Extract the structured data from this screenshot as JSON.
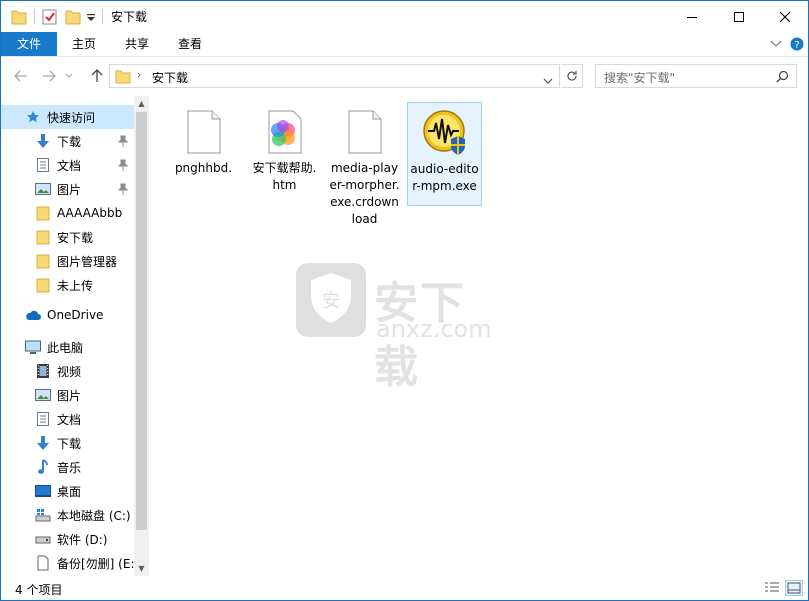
{
  "window": {
    "title": "安下载",
    "accent": "#1979ca"
  },
  "ribbon": {
    "tabs": [
      {
        "label": "文件"
      },
      {
        "label": "主页"
      },
      {
        "label": "共享"
      },
      {
        "label": "查看"
      }
    ]
  },
  "address": {
    "crumb": "安下载",
    "search_placeholder": "搜索\"安下载\""
  },
  "nav": {
    "quick_access": "快速访问",
    "quick_items": [
      {
        "label": "下载",
        "icon": "download-arrow-icon",
        "pinned": true
      },
      {
        "label": "文档",
        "icon": "document-icon",
        "pinned": true
      },
      {
        "label": "图片",
        "icon": "pictures-icon",
        "pinned": true
      },
      {
        "label": "AAAAAbbb",
        "icon": "folder-icon",
        "pinned": false
      },
      {
        "label": "安下载",
        "icon": "folder-icon",
        "pinned": false
      },
      {
        "label": "图片管理器",
        "icon": "folder-icon",
        "pinned": false
      },
      {
        "label": "未上传",
        "icon": "folder-icon",
        "pinned": false
      }
    ],
    "onedrive": "OneDrive",
    "this_pc": "此电脑",
    "pc_items": [
      {
        "label": "视频",
        "icon": "video-icon"
      },
      {
        "label": "图片",
        "icon": "pictures-icon"
      },
      {
        "label": "文档",
        "icon": "document-icon"
      },
      {
        "label": "下载",
        "icon": "download-arrow-icon"
      },
      {
        "label": "音乐",
        "icon": "music-icon"
      },
      {
        "label": "桌面",
        "icon": "desktop-icon"
      },
      {
        "label": "本地磁盘 (C:)",
        "icon": "system-drive-icon"
      },
      {
        "label": "软件 (D:)",
        "icon": "drive-icon"
      },
      {
        "label": "备份[勿删] (E:)",
        "icon": "file-icon"
      }
    ]
  },
  "files": [
    {
      "name": "pnghhbd.",
      "icon": "blank-file-icon",
      "selected": false
    },
    {
      "name": "安下载帮助.htm",
      "icon": "color-wheel-icon",
      "selected": false
    },
    {
      "name": "media-player-morpher.exe.crdownload",
      "icon": "blank-file-icon",
      "selected": false
    },
    {
      "name": "audio-editor-mpm.exe",
      "icon": "audio-editor-app-icon",
      "selected": true
    }
  ],
  "watermark": {
    "title": "安下载",
    "sub": "anxz.com"
  },
  "status": {
    "count": "4 个项目"
  }
}
